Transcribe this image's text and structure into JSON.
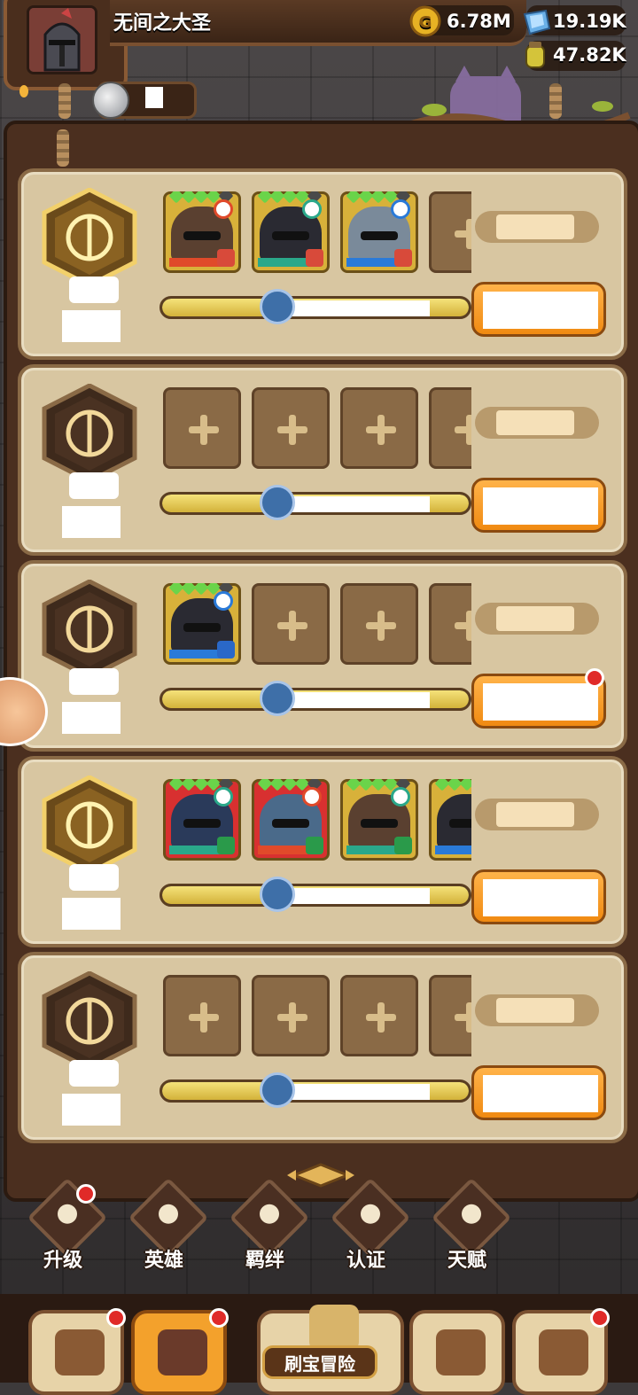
{
  "player": {
    "name": "无间之大圣"
  },
  "resources": {
    "gold": "6.78M",
    "crystal": "19.19K",
    "potion": "47.82K"
  },
  "class_rows": [
    {
      "class_icon": "shield-icon",
      "heroes": [
        {
          "filled": true,
          "element": "fire",
          "role": "tank",
          "frame": "gold"
        },
        {
          "filled": true,
          "element": "wind",
          "role": "tank",
          "frame": "gold"
        },
        {
          "filled": true,
          "element": "water",
          "role": "tank",
          "frame": "gold"
        },
        {
          "filled": false
        }
      ],
      "progress": 0.45
    },
    {
      "class_icon": "staff-icon",
      "heroes": [
        {
          "filled": false
        },
        {
          "filled": false
        },
        {
          "filled": false
        },
        {
          "filled": false
        }
      ],
      "progress": 0.45
    },
    {
      "class_icon": "holy-cross-icon",
      "heroes": [
        {
          "filled": true,
          "element": "water",
          "role": "support",
          "frame": "gold"
        },
        {
          "filled": false
        },
        {
          "filled": false
        },
        {
          "filled": false
        }
      ],
      "progress": 0.45,
      "has_notification": true
    },
    {
      "class_icon": "sword-icon",
      "heroes": [
        {
          "filled": true,
          "element": "wind",
          "role": "warrior",
          "frame": "red"
        },
        {
          "filled": true,
          "element": "fire",
          "role": "warrior",
          "frame": "red"
        },
        {
          "filled": true,
          "element": "wind",
          "role": "warrior",
          "frame": "gold"
        },
        {
          "filled": true,
          "element": "water",
          "role": "warrior",
          "frame": "gold"
        }
      ],
      "progress": 0.45
    },
    {
      "class_icon": "bow-icon",
      "heroes": [
        {
          "filled": false
        },
        {
          "filled": false
        },
        {
          "filled": false
        },
        {
          "filled": false
        }
      ],
      "progress": 0.45
    }
  ],
  "tabs": [
    {
      "label": "升级",
      "icon": "upgrade-icon",
      "badge": true
    },
    {
      "label": "英雄",
      "icon": "hero-icon",
      "badge": false
    },
    {
      "label": "羁绊",
      "icon": "bond-icon",
      "badge": false
    },
    {
      "label": "认证",
      "icon": "eye-icon",
      "badge": false
    },
    {
      "label": "天赋",
      "icon": "talent-icon",
      "badge": false
    }
  ],
  "bottom_nav": {
    "adventure_label": "刷宝冒险",
    "items": [
      {
        "icon": "shop-icon",
        "badge": true
      },
      {
        "icon": "hero-portrait-icon",
        "badge": true,
        "active": true
      },
      {
        "icon": "treasure-map-icon",
        "badge": false
      },
      {
        "icon": "backpack-icon",
        "badge": false
      },
      {
        "icon": "forge-icon",
        "badge": true
      }
    ]
  },
  "colors": {
    "accent_orange": "#f08a12",
    "card_bg": "#d8c6a1",
    "badge_red": "#e02a28",
    "progress_yellow": "#e8cd52"
  }
}
